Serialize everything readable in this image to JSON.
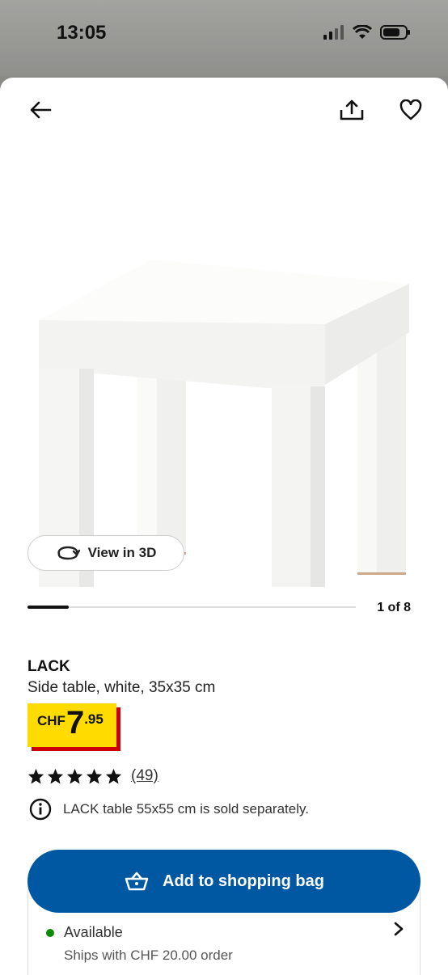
{
  "status_bar": {
    "time": "13:05"
  },
  "header": {
    "back_icon": "arrow-left-icon",
    "share_icon": "share-icon",
    "favorite_icon": "heart-icon"
  },
  "product": {
    "name": "LACK",
    "description": "Side table, white, 35x35 cm",
    "view_3d_label": "View in 3D",
    "image_counter": "1 of 8",
    "image_progress": 0.125,
    "price": {
      "currency": "CHF",
      "integer": "7",
      "decimal": ".95"
    },
    "rating": {
      "stars": 5,
      "count": "(49)"
    },
    "info_note": "LACK table 55x55 cm is sold separately."
  },
  "cta": {
    "label": "Add to shopping bag"
  },
  "availability": {
    "status": "Available",
    "shipping": "Ships with CHF 20.00 order"
  },
  "colors": {
    "accent": "#0058a3",
    "price_yellow": "#ffdb00",
    "price_red": "#cc0008",
    "available_green": "#0a8a00"
  }
}
